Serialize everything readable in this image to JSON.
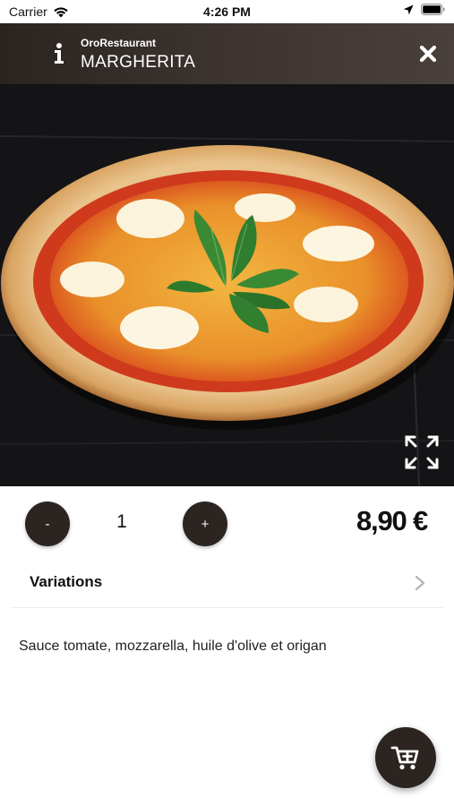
{
  "status_bar": {
    "carrier": "Carrier",
    "time": "4:26 PM"
  },
  "header": {
    "restaurant": "OroRestaurant",
    "title": "MARGHERITA",
    "info_icon": "info-icon",
    "close_icon": "close-icon"
  },
  "hero": {
    "image": "margherita-pizza-photo",
    "expand_icon": "expand-fullscreen-icon"
  },
  "order": {
    "minus_label": "-",
    "plus_label": "+",
    "quantity": "1",
    "price": "8,90 €"
  },
  "variations": {
    "label": "Variations",
    "chevron_icon": "chevron-right-icon"
  },
  "description": "Sauce tomate, mozzarella, huile d'olive et origan",
  "cart_button": {
    "icon": "add-to-cart-icon"
  },
  "colors": {
    "header_bg": "#3a312d",
    "button_bg": "#2b2421",
    "photo_bg": "#17171a"
  }
}
